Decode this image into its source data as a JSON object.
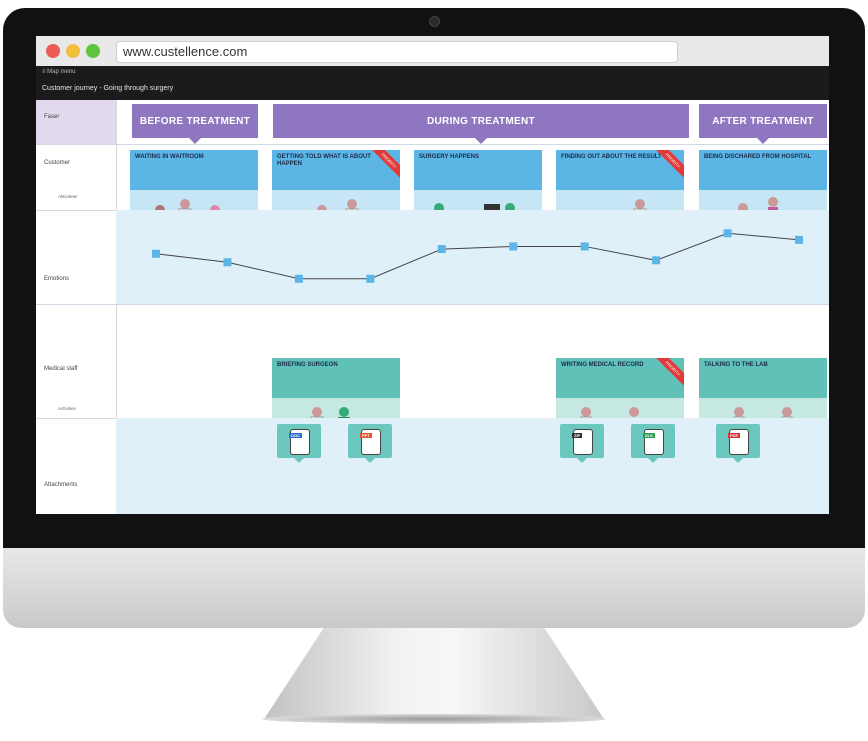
{
  "browser": {
    "url": "www.custellence.com",
    "traffic_lights": {
      "close": "#ee5d55",
      "minimize": "#f3be3b",
      "zoom": "#5fc53e"
    }
  },
  "app": {
    "menu_label": "Map menu",
    "breadcrumb": "",
    "journey_title": "Customer journey - Going through surgery"
  },
  "rows": {
    "faser": "Faser",
    "customer": "Customer",
    "customer_sub": "Aktiviteter",
    "emotions": "Emotions",
    "medical": "Medical staff",
    "medical_sub": "Activities",
    "attachments": "Attachments"
  },
  "phases": [
    {
      "label": "BEFORE TREATMENT"
    },
    {
      "label": "DURING TREATMENT"
    },
    {
      "label": "AFTER TREATMENT"
    }
  ],
  "customer_cards": [
    {
      "title": "WAITING IN WAITROOM",
      "priority": false
    },
    {
      "title": "GETTING TOLD WHAT IS ABOUT HAPPEN",
      "priority": true
    },
    {
      "title": "SURGERY HAPPENS",
      "priority": false
    },
    {
      "title": "FINDING OUT ABOUT THE RESULT",
      "priority": true
    },
    {
      "title": "BEING DISCHARED FROM HOSPITAL",
      "priority": false
    }
  ],
  "priority_label": "PRIORITY",
  "medical_cards": [
    {
      "title": "BRIEFING SURGEON",
      "priority": false
    },
    {
      "title": "WRITING MEDICAL RECORD",
      "priority": true
    },
    {
      "title": "TALKING TO THE LAB",
      "priority": false
    }
  ],
  "attachments": [
    {
      "type": "DOC",
      "color": "#2f6fd1"
    },
    {
      "type": "PPT",
      "color": "#e0572f"
    },
    {
      "type": "ZIP",
      "color": "#333333"
    },
    {
      "type": "XLS",
      "color": "#2e9e4f"
    },
    {
      "type": "PDF",
      "color": "#d8343a"
    }
  ],
  "emotion_levels": [
    0.55,
    0.42,
    0.17,
    0.17,
    0.62,
    0.66,
    0.66,
    0.45,
    0.86,
    0.76
  ],
  "colors": {
    "phase": "#8e76c0",
    "customer_card": "#5bb6e6",
    "medical_card": "#5fc1b8",
    "emotion_point": "#5bb6e6",
    "priority": "#e23a3a"
  }
}
